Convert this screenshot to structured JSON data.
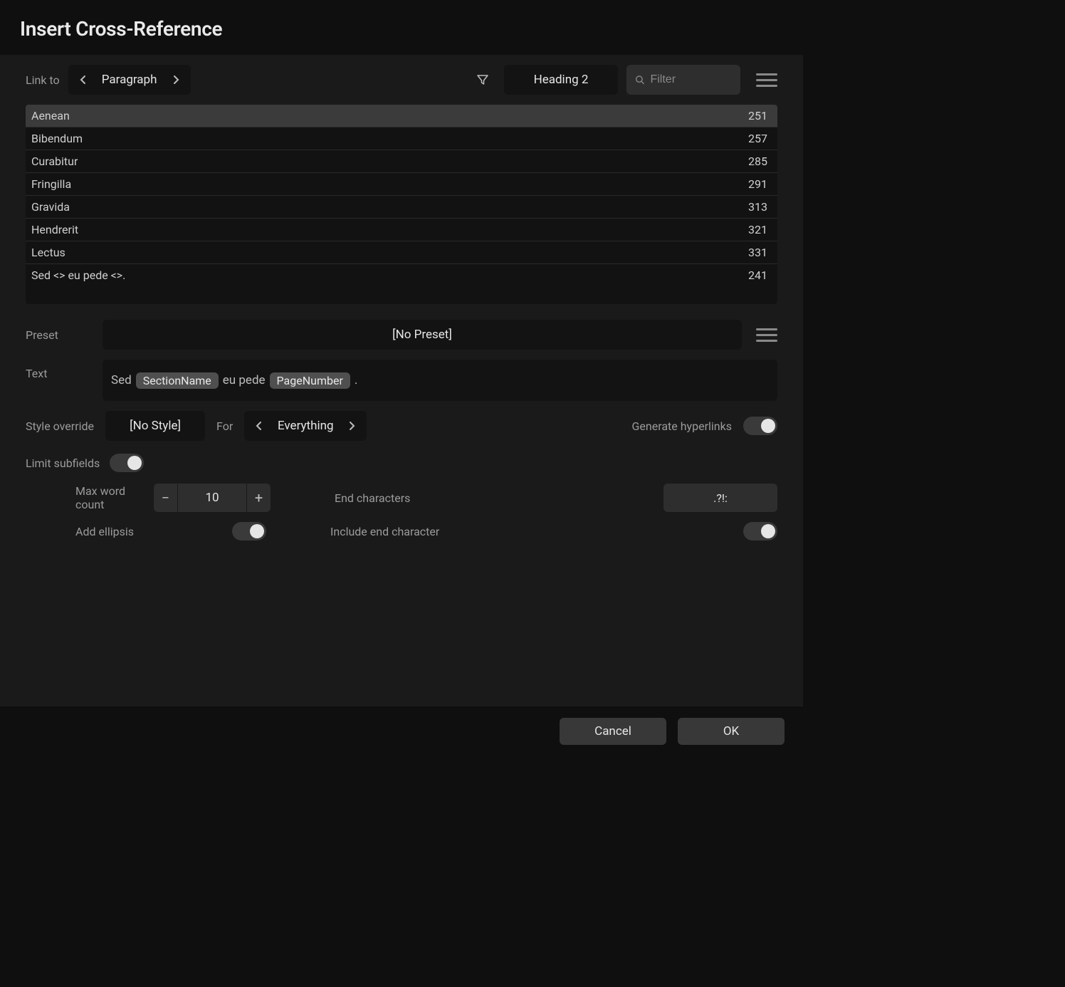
{
  "title": "Insert Cross-Reference",
  "linkto": {
    "label": "Link to",
    "type": "Paragraph",
    "filter_style": "Heading 2"
  },
  "search": {
    "placeholder": "Filter",
    "value": ""
  },
  "results": [
    {
      "name": "Aenean",
      "page": "251",
      "selected": true
    },
    {
      "name": "Bibendum",
      "page": "257",
      "selected": false
    },
    {
      "name": "Curabitur",
      "page": "285",
      "selected": false
    },
    {
      "name": "Fringilla",
      "page": "291",
      "selected": false
    },
    {
      "name": "Gravida",
      "page": "313",
      "selected": false
    },
    {
      "name": "Hendrerit",
      "page": "321",
      "selected": false
    },
    {
      "name": "Lectus",
      "page": "331",
      "selected": false
    },
    {
      "name": "Sed <> eu pede <>.",
      "page": "241",
      "selected": false
    }
  ],
  "preset": {
    "label": "Preset",
    "value": "[No Preset]"
  },
  "text": {
    "label": "Text",
    "parts": [
      {
        "t": "text",
        "v": "Sed "
      },
      {
        "t": "token",
        "v": "SectionName"
      },
      {
        "t": "text",
        "v": " eu pede "
      },
      {
        "t": "token",
        "v": "PageNumber"
      },
      {
        "t": "text",
        "v": " ."
      }
    ]
  },
  "style": {
    "override_label": "Style override",
    "override_value": "[No Style]",
    "for_label": "For",
    "for_value": "Everything",
    "generate_hyperlinks_label": "Generate hyperlinks",
    "generate_hyperlinks_on": true
  },
  "limit": {
    "label": "Limit subfields",
    "on": true,
    "max_word_label": "Max word count",
    "max_word_value": "10",
    "end_chars_label": "End characters",
    "end_chars_value": ".?!:",
    "add_ellipsis_label": "Add ellipsis",
    "add_ellipsis_on": true,
    "include_end_label": "Include end character",
    "include_end_on": true
  },
  "buttons": {
    "cancel": "Cancel",
    "ok": "OK"
  }
}
